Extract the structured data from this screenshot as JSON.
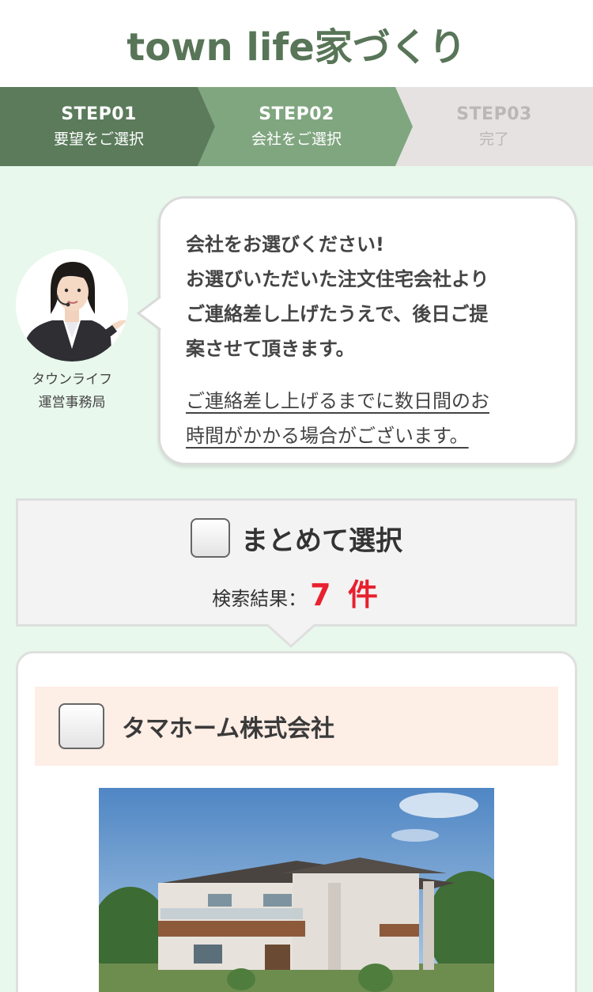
{
  "header": {
    "logo_text": "town life家づくり"
  },
  "steps": [
    {
      "title": "STEP01",
      "subtitle": "要望をご選択",
      "state": "done",
      "color": "#5b7b5b"
    },
    {
      "title": "STEP02",
      "subtitle": "会社をご選択",
      "state": "current",
      "color": "#80a680"
    },
    {
      "title": "STEP03",
      "subtitle": "完了",
      "state": "upcoming",
      "color": "#e6e2e2"
    }
  ],
  "operator": {
    "caption_line1": "タウンライフ",
    "caption_line2": "運営事務局"
  },
  "message": {
    "line1": "会社をお選びください!",
    "line2": "お選びいただいた注文住宅会社より",
    "line3": "ご連絡差し上げたうえで、後日ご提",
    "line4": "案させて頂きます。",
    "note_line1": "ご連絡差し上げるまでに数日間のお",
    "note_line2": "時間がかかる場合がございます。"
  },
  "select_all": {
    "label": "まとめて選択",
    "result_label": "検索結果：",
    "result_count": "7 件"
  },
  "companies": [
    {
      "name": "タマホーム株式会社",
      "checked": false
    }
  ],
  "colors": {
    "brand": "#587558",
    "background": "#e8f8ec",
    "accent_red": "#e8202f",
    "company_bar": "#fdeee6"
  }
}
